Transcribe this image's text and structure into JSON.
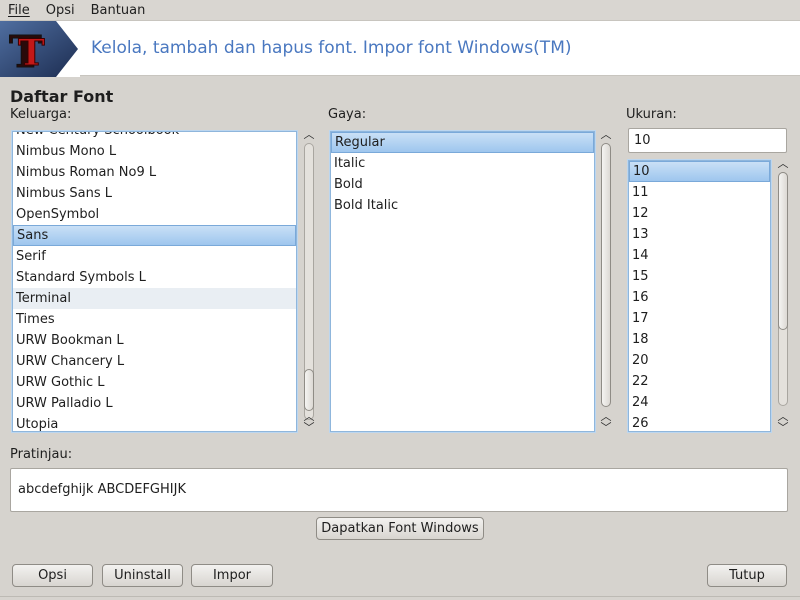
{
  "menubar": {
    "items": [
      {
        "label": "File",
        "accel": "F"
      },
      {
        "label": "Opsi",
        "accel": "O"
      },
      {
        "label": "Bantuan",
        "accel": "B"
      }
    ]
  },
  "banner": {
    "logo_icon": "font-manager-T-icon",
    "title": "Kelola, tambah dan hapus font. Impor font Windows(TM)"
  },
  "font_list": {
    "section_title": "Daftar Font",
    "family": {
      "label": "Keluarga:",
      "items": [
        "New Century Schoolbook",
        "Nimbus Mono L",
        "Nimbus Roman No9 L",
        "Nimbus Sans L",
        "OpenSymbol",
        "Sans",
        "Serif",
        "Standard Symbols L",
        "Terminal",
        "Times",
        "URW Bookman L",
        "URW Chancery L",
        "URW Gothic L",
        "URW Palladio L",
        "Utopia"
      ],
      "selected": "Sans"
    },
    "style": {
      "label": "Gaya:",
      "items": [
        "Regular",
        "Italic",
        "Bold",
        "Bold Italic"
      ],
      "selected": "Regular"
    },
    "size": {
      "label": "Ukuran:",
      "value": "10",
      "items": [
        "10",
        "11",
        "12",
        "13",
        "14",
        "15",
        "16",
        "17",
        "18",
        "20",
        "22",
        "24",
        "26"
      ],
      "selected": "10"
    }
  },
  "preview": {
    "label": "Pratinjau:",
    "text": "abcdefghijk ABCDEFGHIJK"
  },
  "buttons": {
    "get_windows_fonts": "Dapatkan Font Windows",
    "options": "Opsi",
    "uninstall": "Uninstall",
    "import": "Impor",
    "close": "Tutup"
  },
  "colors": {
    "banner_title": "#4a78c0",
    "selection": "#9ec6ee",
    "background": "#d6d3ce"
  }
}
